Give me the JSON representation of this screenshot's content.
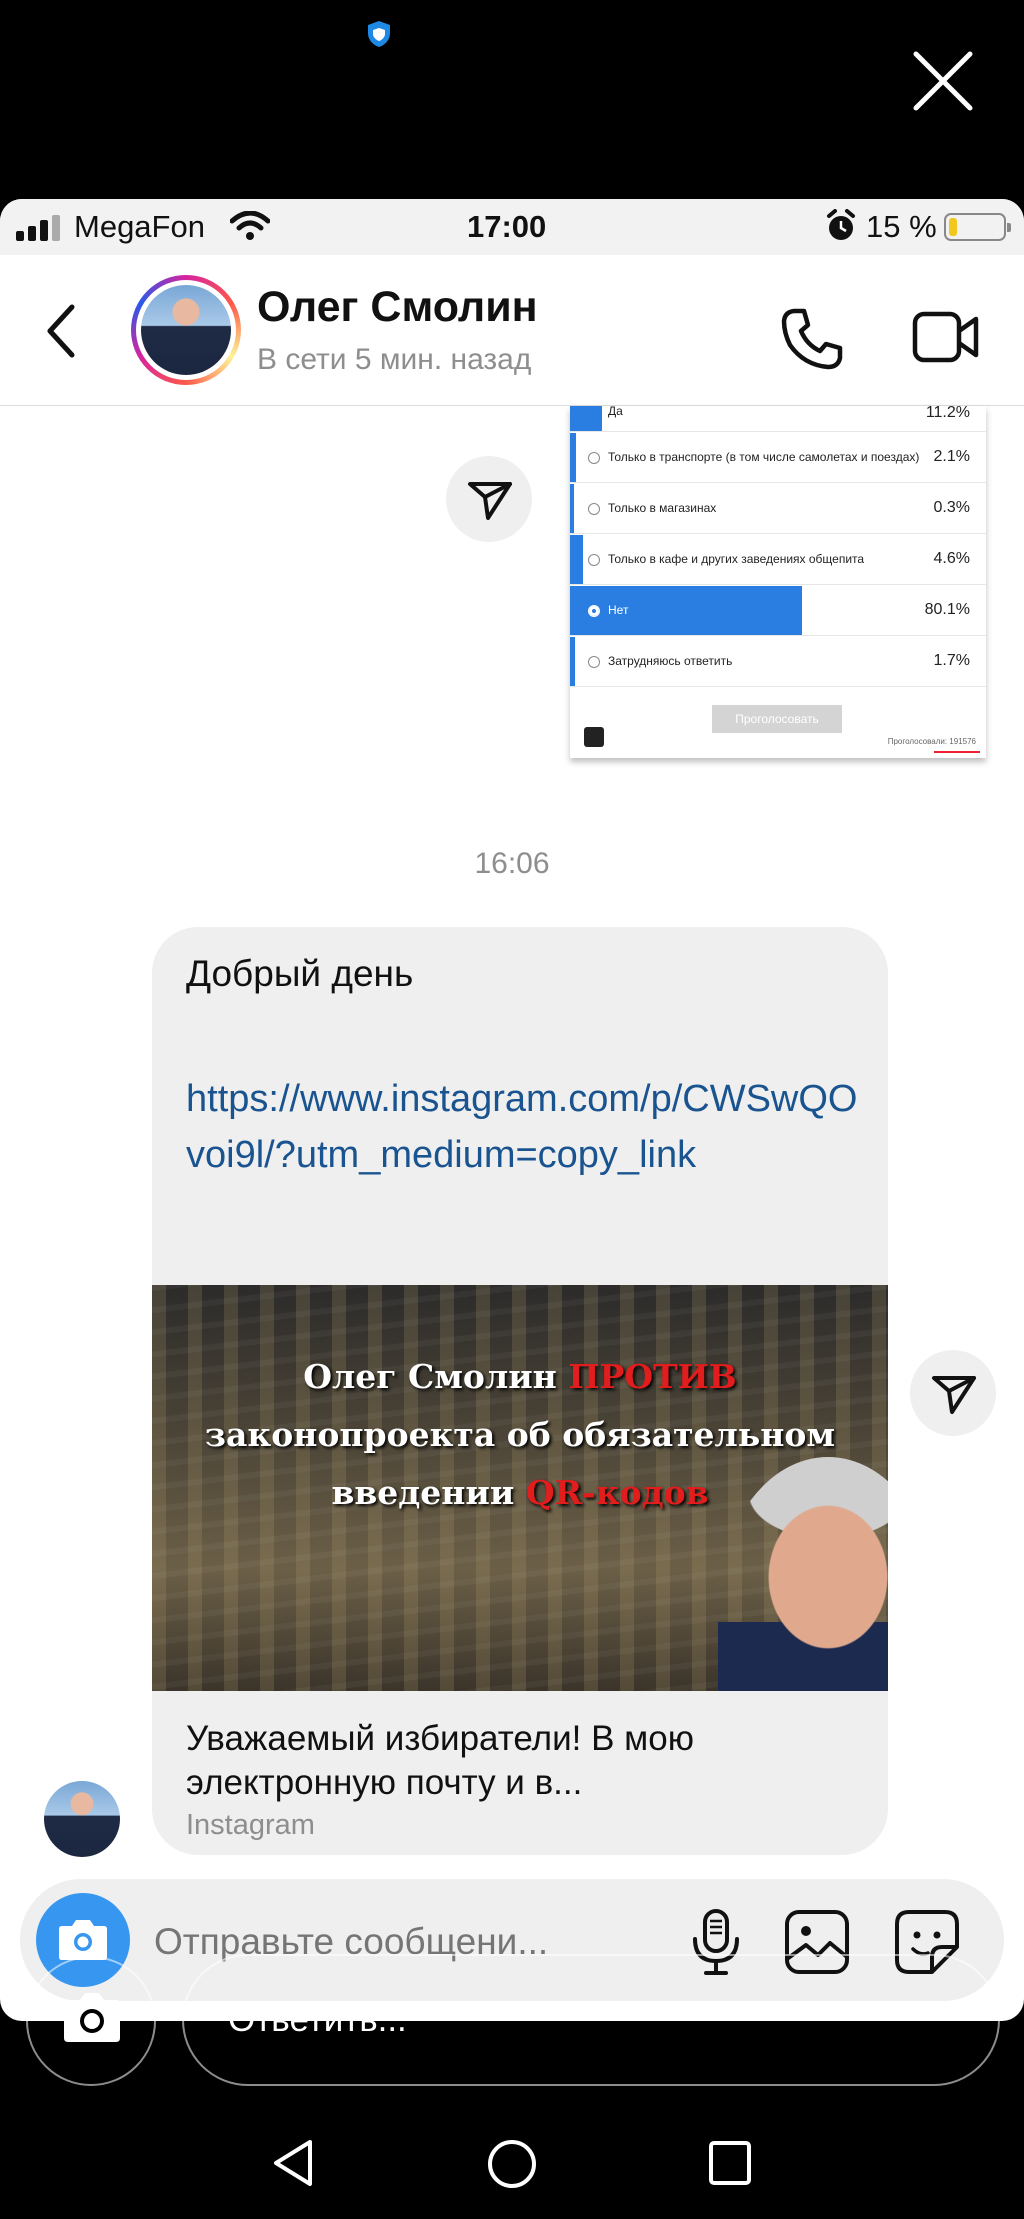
{
  "status_bar": {
    "carrier": "MegaFon",
    "time": "17:00",
    "battery_percent": "15 %",
    "battery_level": 0.15
  },
  "header": {
    "contact_name": "Олег Смолин",
    "contact_status": "В сети 5 мин. назад"
  },
  "poll": {
    "options": [
      {
        "label": "Да",
        "percent": "11.2%",
        "fill": 0.112
      },
      {
        "label": "Только в транспорте (в том числе самолетах и поездах)",
        "percent": "2.1%",
        "fill": 0.021
      },
      {
        "label": "Только в магазинах",
        "percent": "0.3%",
        "fill": 0.003
      },
      {
        "label": "Только в кафе и других заведениях общепита",
        "percent": "4.6%",
        "fill": 0.046
      },
      {
        "label": "Нет",
        "percent": "80.1%",
        "fill": 0.801
      },
      {
        "label": "Затрудняюсь ответить",
        "percent": "1.7%",
        "fill": 0.017
      }
    ],
    "vote_button": "Проголосовать",
    "voted_count": "Проголосовали: 191576"
  },
  "chat": {
    "time_separator": "16:06",
    "message_greeting": "Добрый день",
    "message_link": "https://www.instagram.com/p/CWSwQOvoi9l/?utm_medium=copy_link",
    "preview": {
      "line1_white": "Олег Смолин ",
      "line1_red": "ПРОТИВ",
      "line2": "законопроекта об обязательном",
      "line3_white": "введении ",
      "line3_red": "QR-кодов",
      "title": "Уважаемый избиратели! В мою электронную почту и в...",
      "source": "Instagram"
    }
  },
  "composer": {
    "placeholder": "Отправьте сообщени..."
  },
  "story_reply": {
    "placeholder": "Ответить..."
  },
  "icons": [
    "shield-icon",
    "close-icon",
    "signal-icon",
    "wifi-icon",
    "alarm-icon",
    "battery-icon",
    "back-chevron-icon",
    "phone-icon",
    "video-icon",
    "share-icon",
    "camera-icon",
    "microphone-icon",
    "gallery-icon",
    "sticker-icon",
    "nav-back-icon",
    "nav-home-icon",
    "nav-recent-icon"
  ]
}
